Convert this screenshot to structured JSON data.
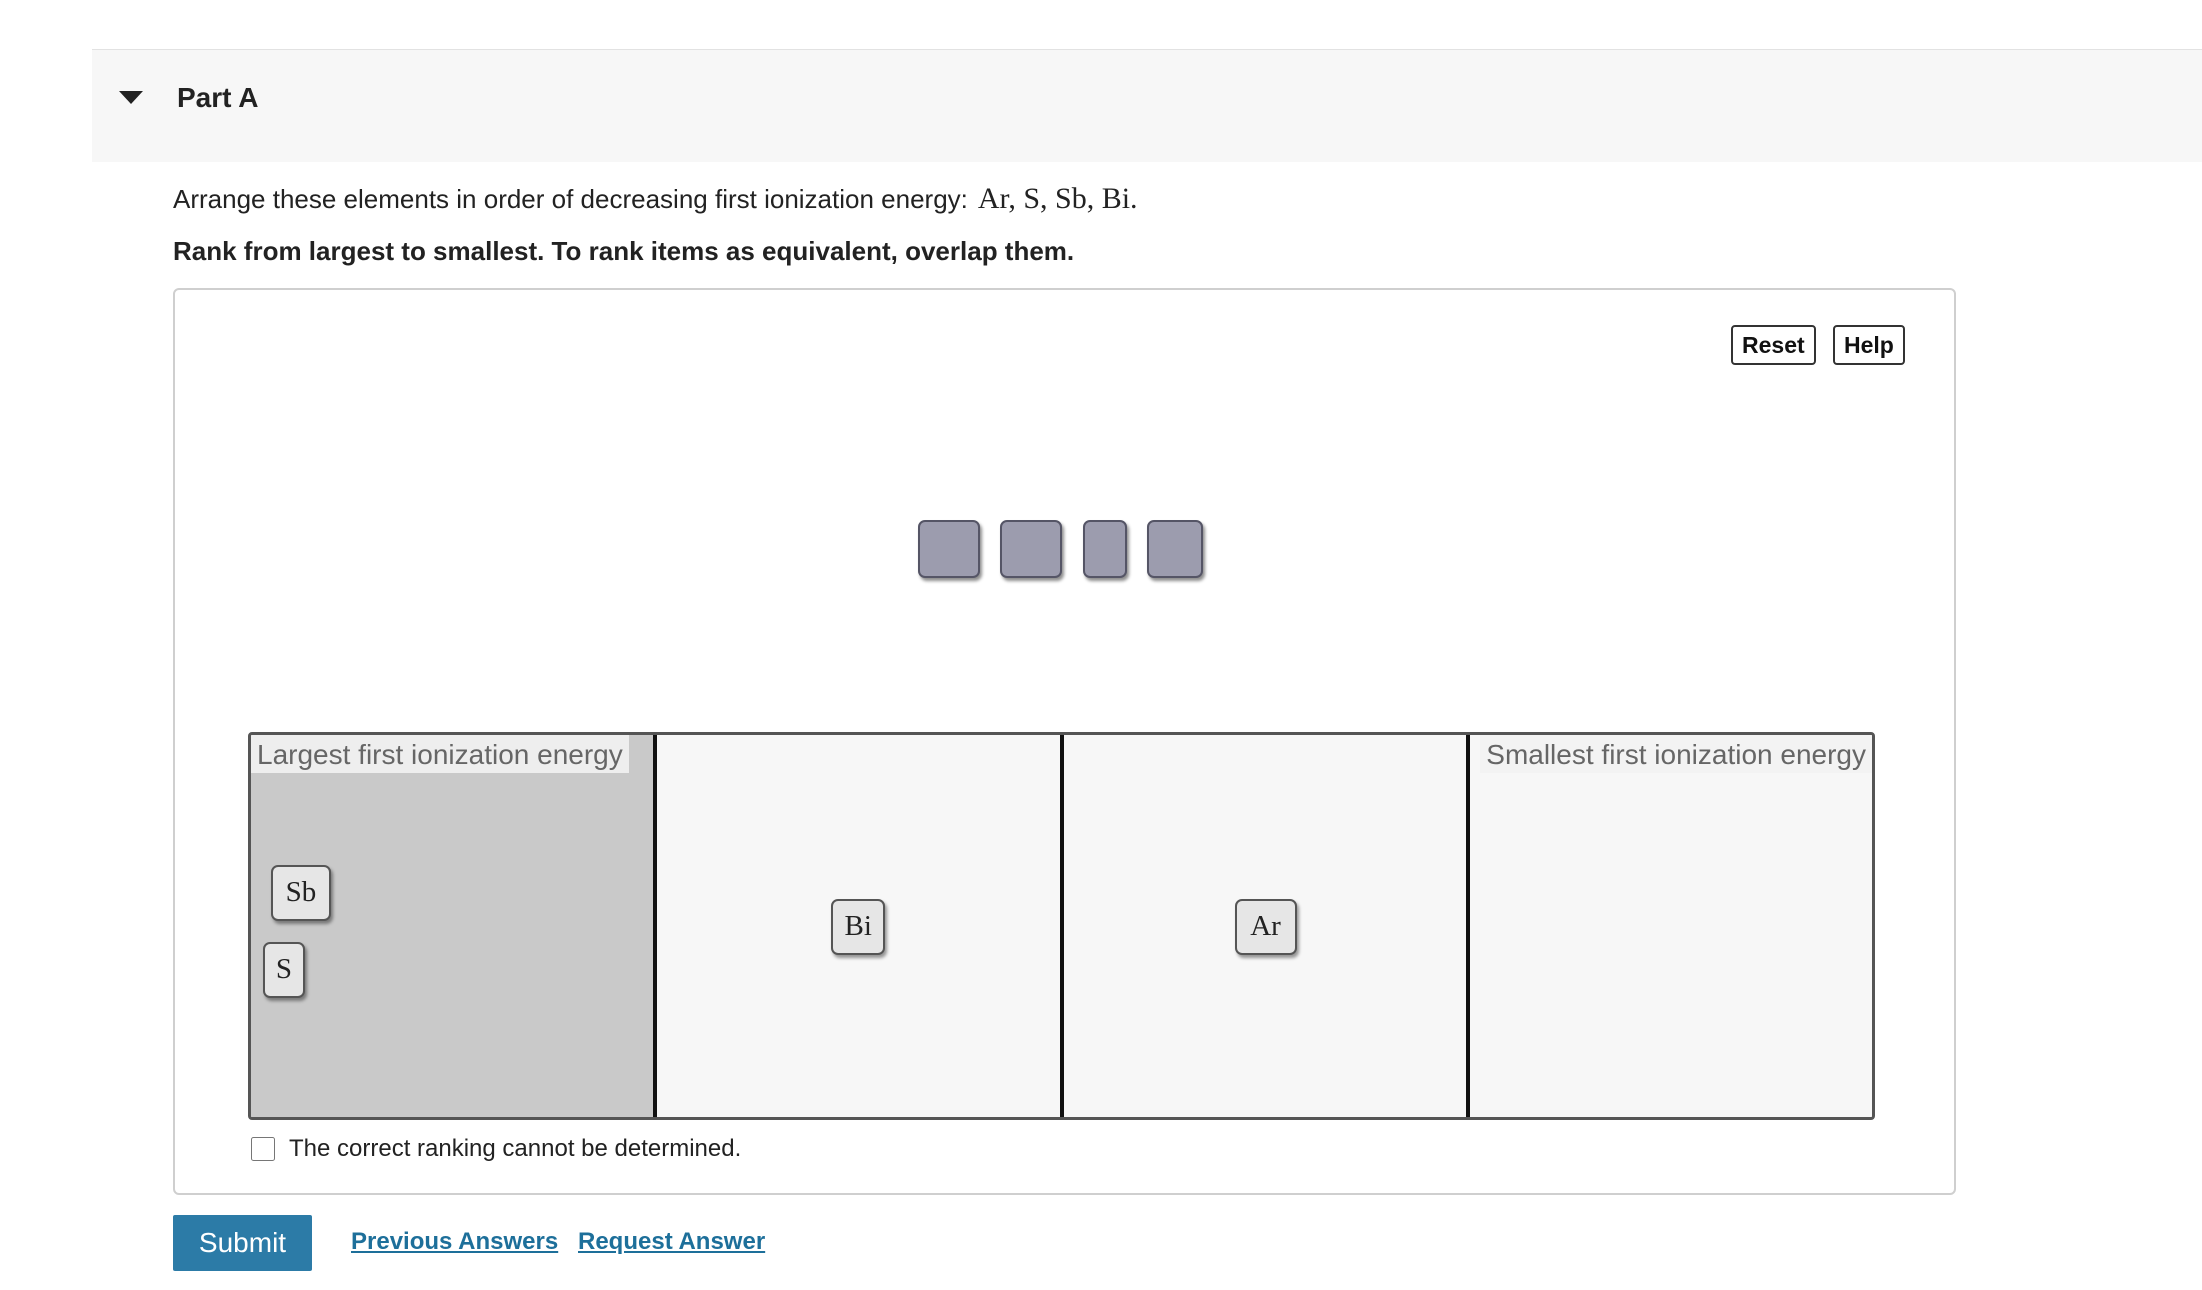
{
  "part": {
    "title": "Part A"
  },
  "question": {
    "prompt": "Arrange these elements in order of decreasing first ionization energy:",
    "elements_math": "Ar,  S, Sb, Bi.",
    "instruction": "Rank from largest to smallest. To rank items as equivalent, overlap them."
  },
  "toolbar": {
    "reset_label": "Reset",
    "help_label": "Help"
  },
  "bins": [
    {
      "label": "Largest first ionization energy",
      "tiles": [
        "Sb",
        "S"
      ]
    },
    {
      "label": "",
      "tiles": [
        "Bi"
      ]
    },
    {
      "label": "",
      "tiles": [
        "Ar"
      ]
    },
    {
      "label": "Smallest first ionization energy",
      "tiles": []
    }
  ],
  "cannot_determine": {
    "label": "The correct ranking cannot be determined.",
    "checked": false
  },
  "actions": {
    "submit_label": "Submit",
    "previous_answers_label": "Previous Answers",
    "request_answer_label": "Request Answer"
  }
}
